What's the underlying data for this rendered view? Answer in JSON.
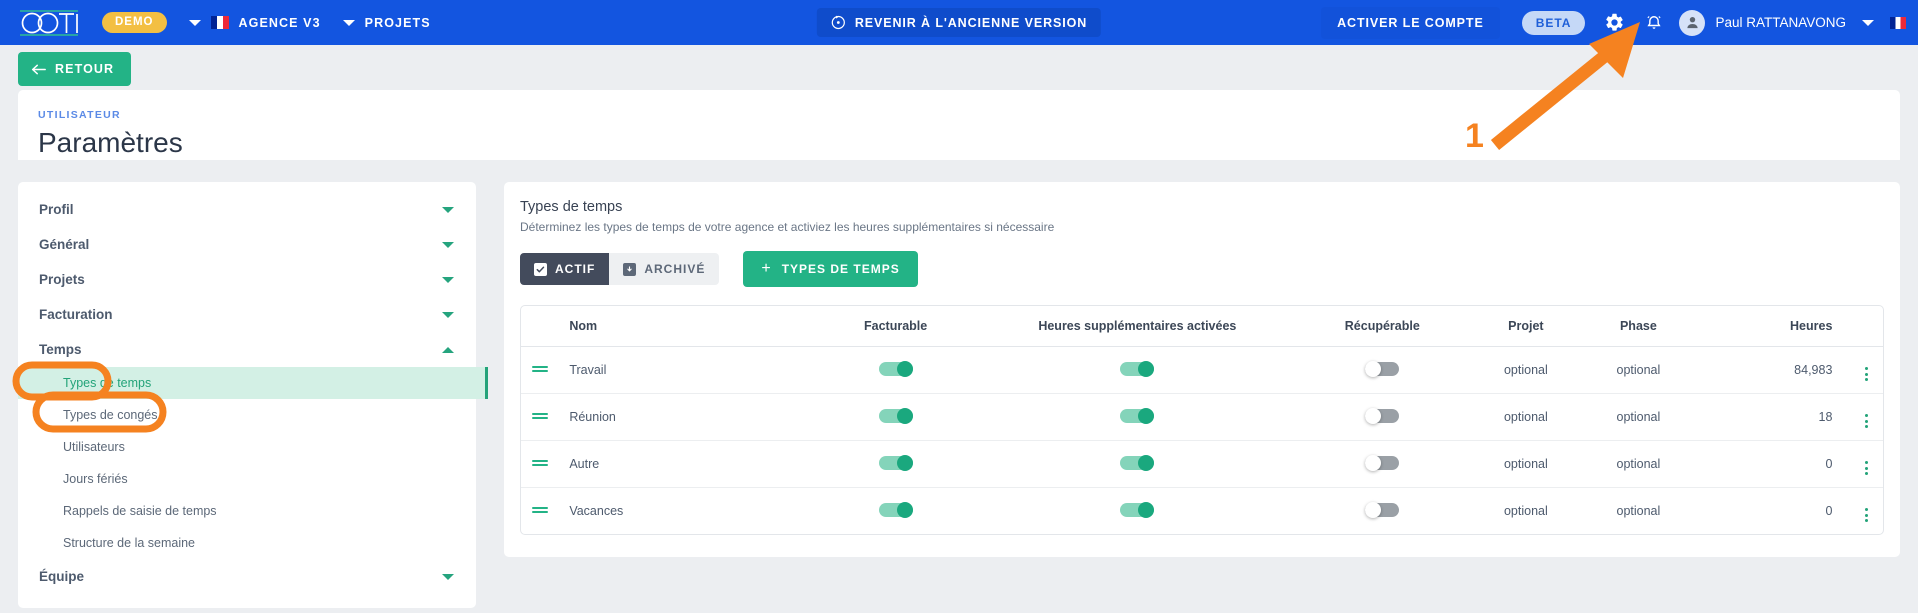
{
  "topbar": {
    "logo_text": "OOTI",
    "demo_badge": "DEMO",
    "agency": "AGENCE V3",
    "projects": "PROJETS",
    "legacy_button": "REVENIR À L'ANCIENNE VERSION",
    "activate_account": "ACTIVER LE COMPTE",
    "beta": "BETA",
    "username": "Paul RATTANAVONG",
    "icons": [
      "history-icon",
      "gear-icon",
      "bell-icon",
      "avatar-icon",
      "chevron-down-icon",
      "flag-fr-icon"
    ]
  },
  "page": {
    "back_button": "RETOUR",
    "kicker": "UTILISATEUR",
    "title": "Paramètres"
  },
  "sidebar": {
    "groups": [
      {
        "label": "Profil",
        "expanded": false
      },
      {
        "label": "Général",
        "expanded": false
      },
      {
        "label": "Projets",
        "expanded": false
      },
      {
        "label": "Facturation",
        "expanded": false
      },
      {
        "label": "Temps",
        "expanded": true
      },
      {
        "label": "Équipe",
        "expanded": false
      }
    ],
    "temps_children": [
      {
        "label": "Types de temps",
        "active": true
      },
      {
        "label": "Types de congés",
        "active": false
      },
      {
        "label": "Utilisateurs",
        "active": false
      },
      {
        "label": "Jours fériés",
        "active": false
      },
      {
        "label": "Rappels de saisie de temps",
        "active": false
      },
      {
        "label": "Structure de la semaine",
        "active": false
      }
    ]
  },
  "panel": {
    "title": "Types de temps",
    "subtitle": "Déterminez les types de temps de votre agence et activiez les heures supplémentaires si nécessaire",
    "seg_active": "ACTIF",
    "seg_archived": "ARCHIVÉ",
    "add_button": "TYPES DE TEMPS",
    "add_plus": "+"
  },
  "table": {
    "headers": {
      "handle": "",
      "nom": "Nom",
      "facturable": "Facturable",
      "heures_sup": "Heures supplémentaires activées",
      "recuperable": "Récupérable",
      "projet": "Projet",
      "phase": "Phase",
      "heures": "Heures"
    },
    "rows": [
      {
        "nom": "Travail",
        "facturable": true,
        "heures_sup": true,
        "recuperable": false,
        "projet": "optional",
        "phase": "optional",
        "heures": "84,983"
      },
      {
        "nom": "Réunion",
        "facturable": true,
        "heures_sup": true,
        "recuperable": false,
        "projet": "optional",
        "phase": "optional",
        "heures": "18"
      },
      {
        "nom": "Autre",
        "facturable": true,
        "heures_sup": true,
        "recuperable": false,
        "projet": "optional",
        "phase": "optional",
        "heures": "0"
      },
      {
        "nom": "Vacances",
        "facturable": true,
        "heures_sup": true,
        "recuperable": false,
        "projet": "optional",
        "phase": "optional",
        "heures": "0"
      }
    ]
  },
  "annotations": {
    "step_number": "1",
    "color": "#f58220",
    "highlights": [
      "Temps",
      "Types de temps"
    ]
  },
  "colors": {
    "topbar_blue": "#1355e0",
    "green": "#23b386",
    "active_green_bg": "#d3f0e5",
    "dark_seg": "#434b5c",
    "annotation_orange": "#f58220"
  }
}
